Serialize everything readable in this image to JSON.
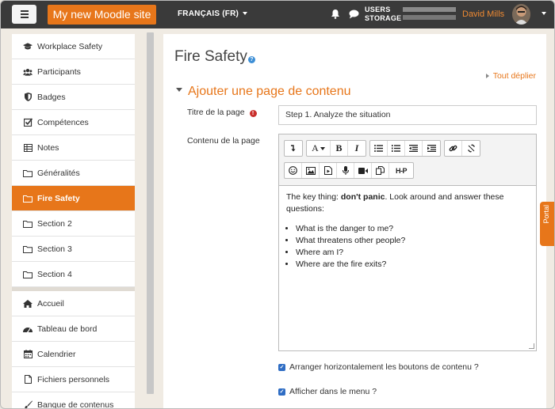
{
  "navbar": {
    "site_name": "My new Moodle site",
    "language": "FRANÇAIS (FR)",
    "storage_label_line1": "USERS",
    "storage_label_line2": "STORAGE",
    "user_name": "David Mills"
  },
  "sidebar": {
    "course_items": [
      {
        "label": "Workplace Safety",
        "icon": "graduation-cap-icon"
      },
      {
        "label": "Participants",
        "icon": "users-icon"
      },
      {
        "label": "Badges",
        "icon": "shield-icon"
      },
      {
        "label": "Compétences",
        "icon": "checkbox-icon"
      },
      {
        "label": "Notes",
        "icon": "table-icon"
      },
      {
        "label": "Généralités",
        "icon": "folder-icon"
      },
      {
        "label": "Fire Safety",
        "icon": "folder-icon",
        "active": true
      },
      {
        "label": "Section 2",
        "icon": "folder-icon"
      },
      {
        "label": "Section 3",
        "icon": "folder-icon"
      },
      {
        "label": "Section 4",
        "icon": "folder-icon"
      }
    ],
    "site_items": [
      {
        "label": "Accueil",
        "icon": "home-icon"
      },
      {
        "label": "Tableau de bord",
        "icon": "dashboard-icon"
      },
      {
        "label": "Calendrier",
        "icon": "calendar-icon"
      },
      {
        "label": "Fichiers personnels",
        "icon": "file-icon"
      },
      {
        "label": "Banque de contenus",
        "icon": "paint-brush-icon"
      }
    ]
  },
  "main": {
    "page_title": "Fire Safety",
    "expand_all": "Tout déplier",
    "section_heading": "Ajouter une page de contenu",
    "title_label": "Titre de la page",
    "title_value": "Step 1. Analyze the situation",
    "content_label": "Contenu de la page",
    "content": {
      "intro_before": "The key thing: ",
      "intro_bold": "don't panic",
      "intro_after": ". Look around and answer these questions:",
      "questions": [
        "What is the danger to me?",
        "What threatens other people?",
        "Where am I?",
        "Where are the fire exits?"
      ]
    },
    "checkboxes": [
      {
        "label": "Arranger horizontalement les boutons de contenu ?",
        "checked": true
      },
      {
        "label": "Afficher dans le menu ?",
        "checked": true
      }
    ]
  },
  "toolbar": {
    "row1": [
      "collapse-icon",
      "font-size-icon",
      "bold-icon",
      "italic-icon",
      "bullet-list-icon",
      "numbered-list-icon",
      "outdent-icon",
      "indent-icon",
      "link-icon",
      "unlink-icon"
    ],
    "row2": [
      "emoji-icon",
      "image-icon",
      "media-icon",
      "record-audio-icon",
      "record-video-icon",
      "manage-files-icon",
      "h5p-icon"
    ],
    "font_label": "A",
    "bold_label": "B",
    "italic_label": "I",
    "h5p_label": "H-P"
  },
  "portal_tab": "Portal",
  "colors": {
    "accent": "#e7761a",
    "navbar": "#3a3a3a",
    "checkbox": "#2f6dc4",
    "required": "#c9302c"
  }
}
